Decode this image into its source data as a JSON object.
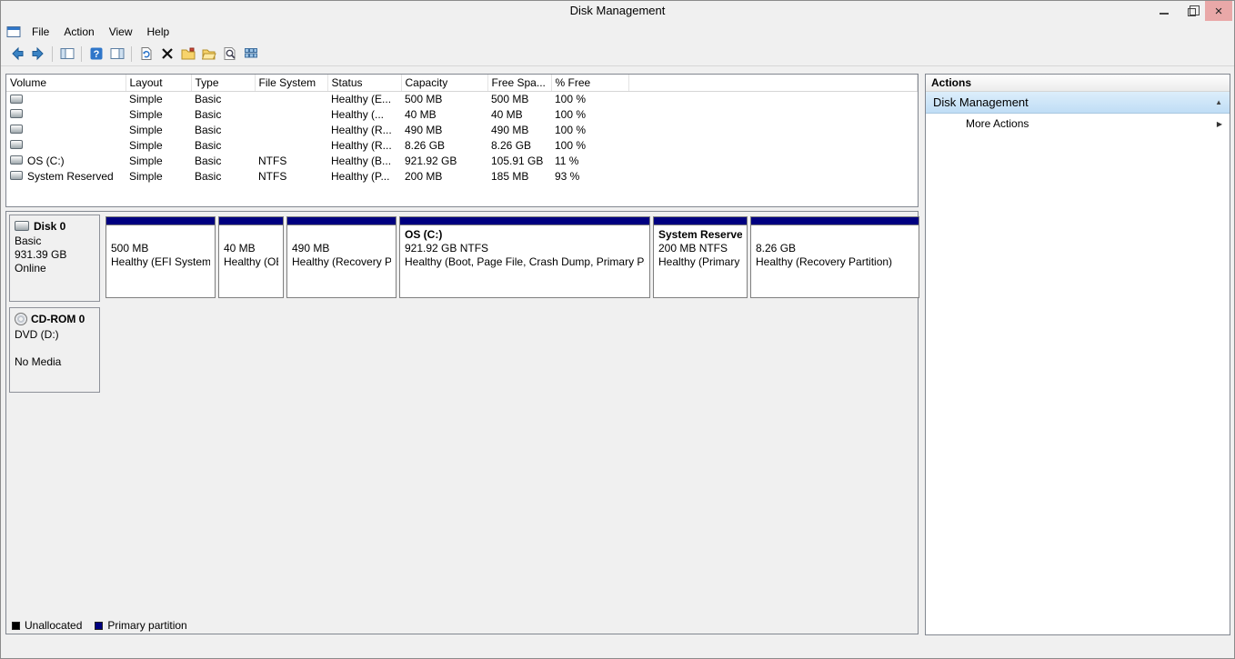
{
  "window": {
    "title": "Disk Management"
  },
  "menu": {
    "items": [
      {
        "label": "File"
      },
      {
        "label": "Action"
      },
      {
        "label": "View"
      },
      {
        "label": "Help"
      }
    ]
  },
  "toolbar": {
    "icons": [
      "back-icon",
      "forward-icon",
      "show-console-tree-icon",
      "help-icon",
      "show-action-pane-icon",
      "refresh-icon",
      "delete-icon",
      "drive-letter-icon",
      "open-folder-icon",
      "explore-icon",
      "view-list-icon"
    ]
  },
  "volume_table": {
    "columns": [
      "Volume",
      "Layout",
      "Type",
      "File System",
      "Status",
      "Capacity",
      "Free Spa...",
      "% Free"
    ],
    "rows": [
      {
        "volume": "",
        "layout": "Simple",
        "type": "Basic",
        "fs": "",
        "status": "Healthy (E...",
        "capacity": "500 MB",
        "free": "500 MB",
        "pct": "100 %"
      },
      {
        "volume": "",
        "layout": "Simple",
        "type": "Basic",
        "fs": "",
        "status": "Healthy (...",
        "capacity": "40 MB",
        "free": "40 MB",
        "pct": "100 %"
      },
      {
        "volume": "",
        "layout": "Simple",
        "type": "Basic",
        "fs": "",
        "status": "Healthy (R...",
        "capacity": "490 MB",
        "free": "490 MB",
        "pct": "100 %"
      },
      {
        "volume": "",
        "layout": "Simple",
        "type": "Basic",
        "fs": "",
        "status": "Healthy (R...",
        "capacity": "8.26 GB",
        "free": "8.26 GB",
        "pct": "100 %"
      },
      {
        "volume": "OS (C:)",
        "layout": "Simple",
        "type": "Basic",
        "fs": "NTFS",
        "status": "Healthy (B...",
        "capacity": "921.92 GB",
        "free": "105.91 GB",
        "pct": "11 %"
      },
      {
        "volume": "System Reserved",
        "layout": "Simple",
        "type": "Basic",
        "fs": "NTFS",
        "status": "Healthy (P...",
        "capacity": "200 MB",
        "free": "185 MB",
        "pct": "93 %"
      }
    ]
  },
  "graphical": {
    "disks": [
      {
        "name": "Disk 0",
        "lines": [
          "Basic",
          "931.39 GB",
          "Online"
        ],
        "partitions": [
          {
            "title": "",
            "size": "500 MB",
            "status": "Healthy (EFI System Partition)"
          },
          {
            "title": "",
            "size": "40 MB",
            "status": "Healthy (OEM Partition)"
          },
          {
            "title": "",
            "size": "490 MB",
            "status": "Healthy (Recovery Partition)"
          },
          {
            "title": "OS  (C:)",
            "size": "921.92 GB NTFS",
            "status": "Healthy (Boot, Page File, Crash Dump, Primary Partition)"
          },
          {
            "title": "System Reserved",
            "size": "200 MB NTFS",
            "status": "Healthy (Primary Partition)"
          },
          {
            "title": "",
            "size": "8.26 GB",
            "status": "Healthy (Recovery Partition)"
          }
        ]
      },
      {
        "name": "CD-ROM 0",
        "lines": [
          "DVD (D:)",
          "",
          "No Media"
        ]
      }
    ]
  },
  "legend": {
    "items": [
      {
        "label": "Unallocated",
        "color": "#000000"
      },
      {
        "label": "Primary partition",
        "color": "#000080"
      }
    ]
  },
  "actions": {
    "panel_title": "Actions",
    "group_title": "Disk Management",
    "more_label": "More Actions"
  },
  "colors": {
    "primary_partition": "#000080",
    "unallocated": "#000000"
  }
}
